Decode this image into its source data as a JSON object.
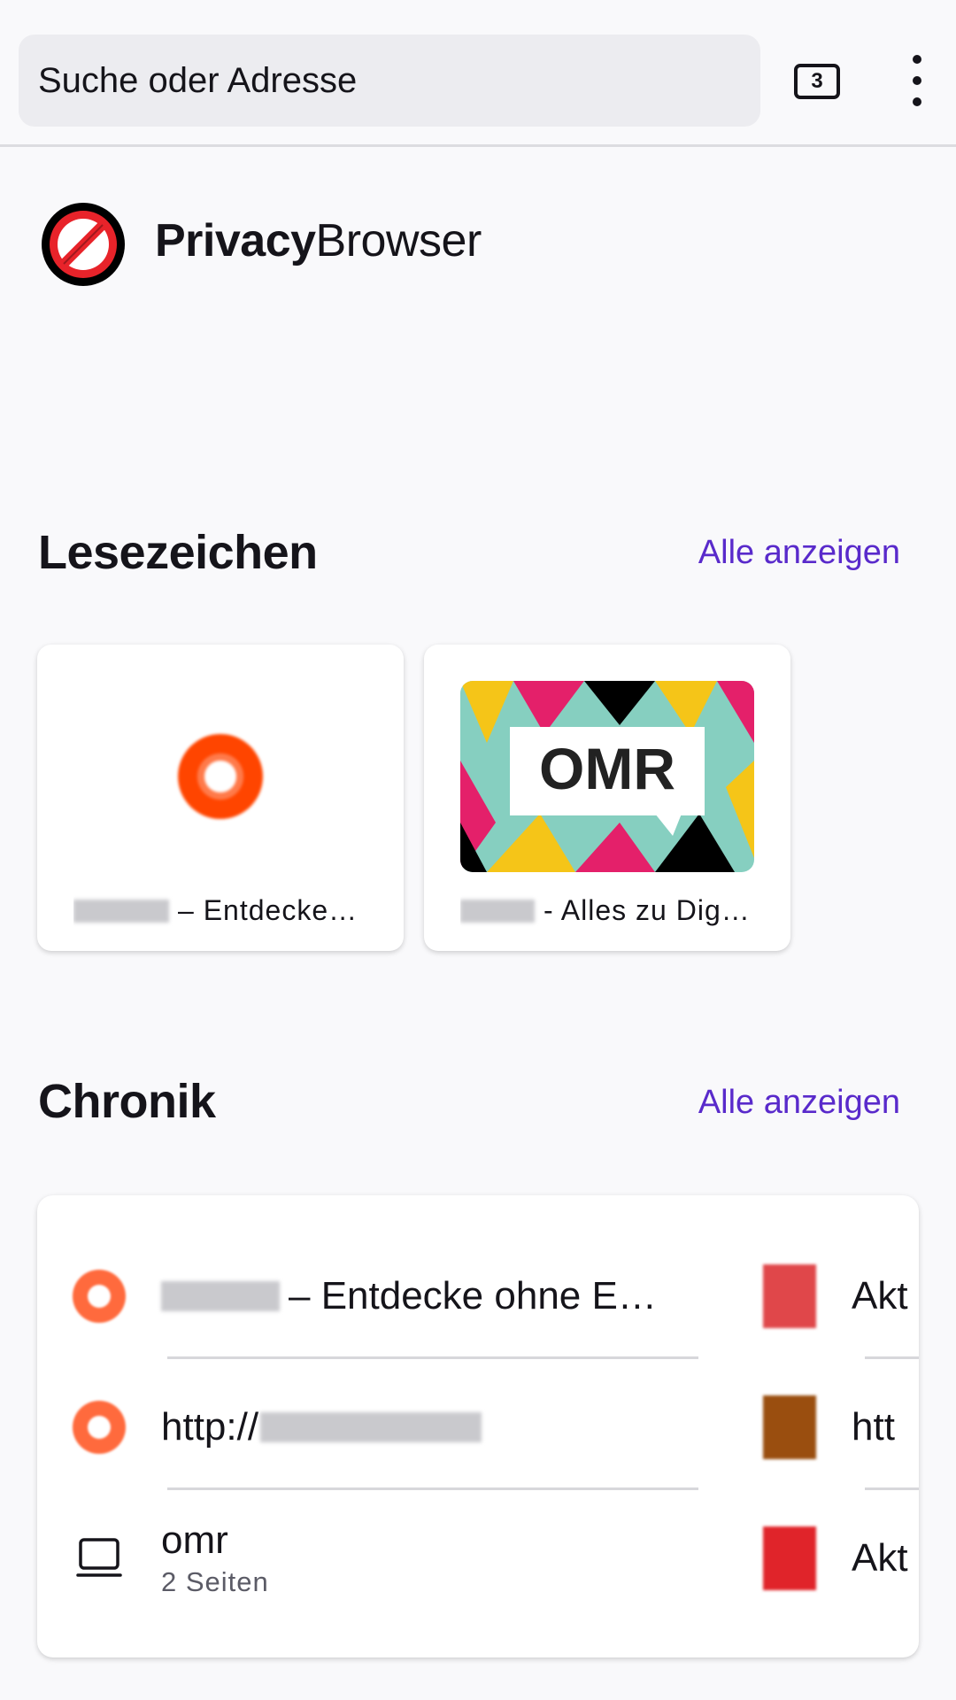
{
  "toolbar": {
    "search_placeholder": "Suche oder Adresse",
    "tab_count": "3"
  },
  "brand": {
    "name_bold": "Privacy",
    "name_regular": "Browser"
  },
  "bookmarks": {
    "title": "Lesezeichen",
    "show_all": "Alle anzeigen",
    "items": [
      {
        "caption": "– Entdecke…"
      },
      {
        "caption": "- Alles zu Dig…",
        "thumb_text": "OMR"
      }
    ]
  },
  "history": {
    "title": "Chronik",
    "show_all": "Alle anzeigen",
    "left_items": [
      {
        "text": "– Entdecke ohne E…"
      },
      {
        "text": "http://"
      },
      {
        "text": "omr",
        "sub": "2 Seiten"
      }
    ],
    "right_items": [
      {
        "text": "Akt"
      },
      {
        "text": "htt"
      },
      {
        "text": "Akt"
      }
    ]
  },
  "colors": {
    "accent": "#592acb",
    "background": "#f9f9fb",
    "urlbar": "#ececf0"
  }
}
